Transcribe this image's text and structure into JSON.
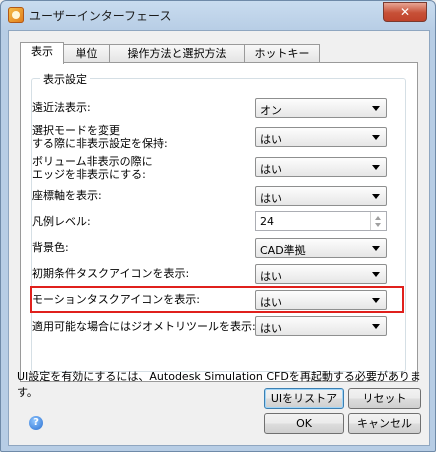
{
  "window": {
    "title": "ユーザーインターフェース",
    "close_symbol": "✕"
  },
  "tabs": [
    {
      "label": "表示",
      "active": true
    },
    {
      "label": "単位",
      "active": false
    },
    {
      "label": "操作方法と選択方法",
      "active": false
    },
    {
      "label": "ホットキー",
      "active": false
    }
  ],
  "group": {
    "title": "表示設定"
  },
  "settings": [
    {
      "label": "遠近法表示:",
      "value": "オン"
    },
    {
      "label_line1": "選択モードを変更",
      "label_line2": "する際に非表示設定を保持:",
      "value": "はい"
    },
    {
      "label_line1": "ボリューム非表示の際に",
      "label_line2": "エッジを非表示にする:",
      "value": "はい"
    },
    {
      "label": "座標軸を表示:",
      "value": "はい"
    },
    {
      "label": "凡例レベル:",
      "value": "24"
    },
    {
      "label": "背景色:",
      "value": "CAD準拠"
    },
    {
      "label": "初期条件タスクアイコンを表示:",
      "value": "はい"
    },
    {
      "label": "モーションタスクアイコンを表示:",
      "value": "はい"
    },
    {
      "label": "適用可能な場合にはジオメトリツールを表示:",
      "value": "はい"
    }
  ],
  "message": "UI設定を有効にするには、Autodesk Simulation CFDを再起動する必要があります。",
  "buttons": {
    "restore": "UIをリストア",
    "reset": "リセット",
    "ok": "OK",
    "cancel": "キャンセル"
  },
  "help_symbol": "?",
  "colors": {
    "highlight": "#e0201c",
    "title_bar": "#b7cde5"
  }
}
